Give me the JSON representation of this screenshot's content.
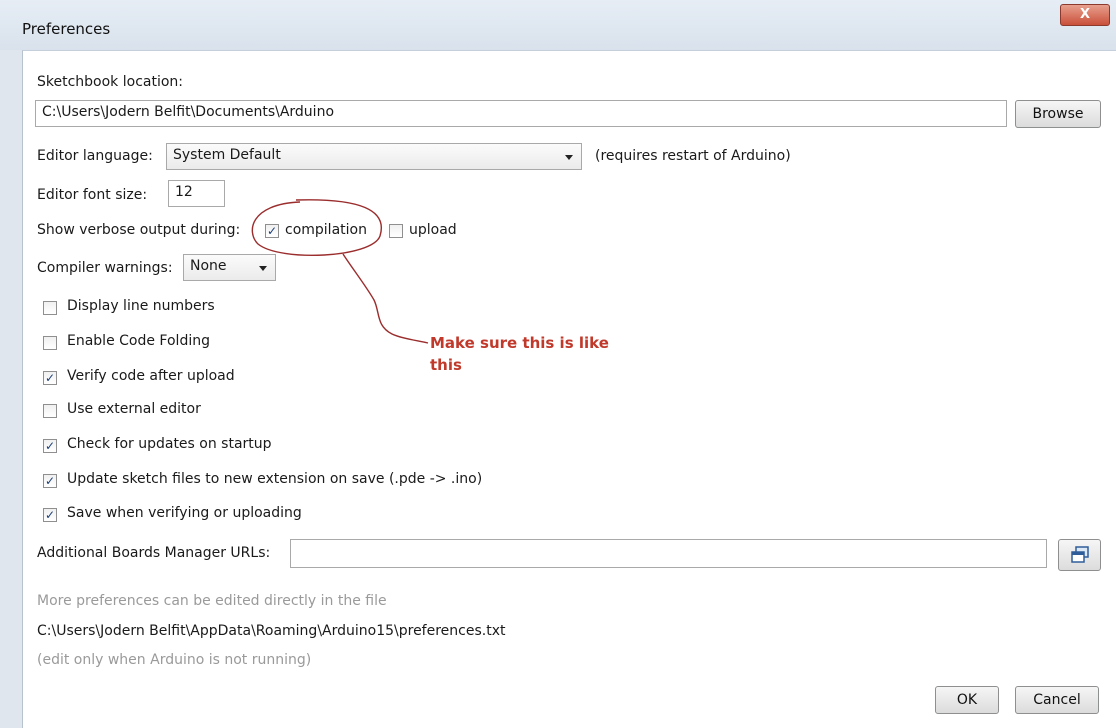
{
  "window": {
    "title": "Preferences",
    "close_glyph": "X"
  },
  "sketchbook": {
    "label": "Sketchbook location:",
    "path": "C:\\Users\\Jodern Belfit\\Documents\\Arduino",
    "browse_label": "Browse"
  },
  "editor_language": {
    "label": "Editor language:",
    "selected": "System Default",
    "note": "(requires restart of Arduino)"
  },
  "font_size": {
    "label": "Editor font size:",
    "value": "12"
  },
  "verbose": {
    "label": "Show verbose output during:",
    "compilation_label": "compilation",
    "compilation_checked": true,
    "upload_label": "upload",
    "upload_checked": false
  },
  "compiler_warnings": {
    "label": "Compiler warnings:",
    "selected": "None"
  },
  "options": [
    {
      "label": "Display line numbers",
      "checked": false
    },
    {
      "label": "Enable Code Folding",
      "checked": false
    },
    {
      "label": "Verify code after upload",
      "checked": true
    },
    {
      "label": "Use external editor",
      "checked": false
    },
    {
      "label": "Check for updates on startup",
      "checked": true
    },
    {
      "label": "Update sketch files to new extension on save (.pde -> .ino)",
      "checked": true
    },
    {
      "label": "Save when verifying or uploading",
      "checked": true
    }
  ],
  "boards_manager": {
    "label": "Additional Boards Manager URLs:",
    "value": ""
  },
  "footer": {
    "more_prefs": "More preferences can be edited directly in the file",
    "prefs_path": "C:\\Users\\Jodern Belfit\\AppData\\Roaming\\Arduino15\\preferences.txt",
    "edit_note": "(edit only when Arduino is not running)",
    "ok_label": "OK",
    "cancel_label": "Cancel"
  },
  "annotation": {
    "line1": "Make sure this is like",
    "line2": "this",
    "color": "#c0392b"
  },
  "check_glyph": "✓"
}
